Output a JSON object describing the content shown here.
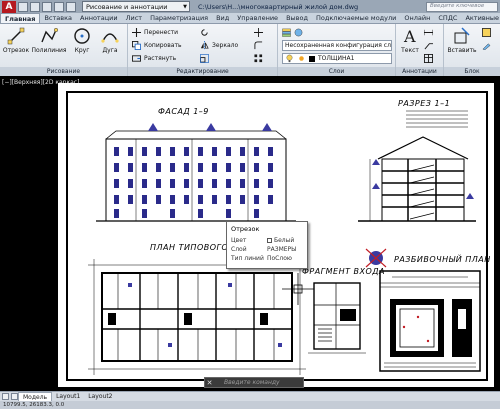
{
  "titlebar": {
    "logo": "A",
    "workspace": "Рисование и аннотации",
    "title": "C:\\Users\\H...\\многоквартирный жилой дом.dwg",
    "search_placeholder": "Введите ключевое"
  },
  "tabs": [
    "Главная",
    "Вставка",
    "Аннотации",
    "Лист",
    "Параметризация",
    "Вид",
    "Управление",
    "Вывод",
    "Подключаемые модули",
    "Онлайн",
    "СПДС",
    "Активные"
  ],
  "ribbon": {
    "draw": {
      "label": "Рисование",
      "line": "Отрезок",
      "polyline": "Полилиния",
      "circle": "Круг",
      "arc": "Дуга"
    },
    "modify": {
      "label": "Редактирование",
      "move": "Перенести",
      "copy": "Копировать",
      "stretch": "Растянуть",
      "mirror": "Зеркало"
    },
    "layers": {
      "label": "Слои",
      "unsaved": "Несохраненная конфигурация сло",
      "current": "ТОЛЩИНА1"
    },
    "annotations": {
      "label": "Аннотации",
      "text": "Текст"
    },
    "block": {
      "label": "Блок",
      "insert": "Вставить"
    }
  },
  "viewport": {
    "label": "[−][Верхняя][2D каркас]"
  },
  "drawing": {
    "facade": "ФАСАД 1–9",
    "section": "РАЗРЕЗ 1–1",
    "plan": "ПЛАН ТИПОВОГО Э",
    "fragment": "ФРАГМЕНТ ВХОДА",
    "layout_plan": "РАЗБИВОЧНЫЙ ПЛАН"
  },
  "tooltip": {
    "title": "Отрезок",
    "rows": [
      {
        "key": "Цвет",
        "value": "Белый"
      },
      {
        "key": "Слой",
        "value": "РАЗМЕРЫ"
      },
      {
        "key": "Тип линий",
        "value": "ПоСлою"
      }
    ]
  },
  "cmdline": {
    "placeholder": "Введите команду"
  },
  "layout_tabs": [
    "Модель",
    "Layout1",
    "Layout2"
  ],
  "status": {
    "coords": "10799.5, 26183.3, 0.0"
  }
}
